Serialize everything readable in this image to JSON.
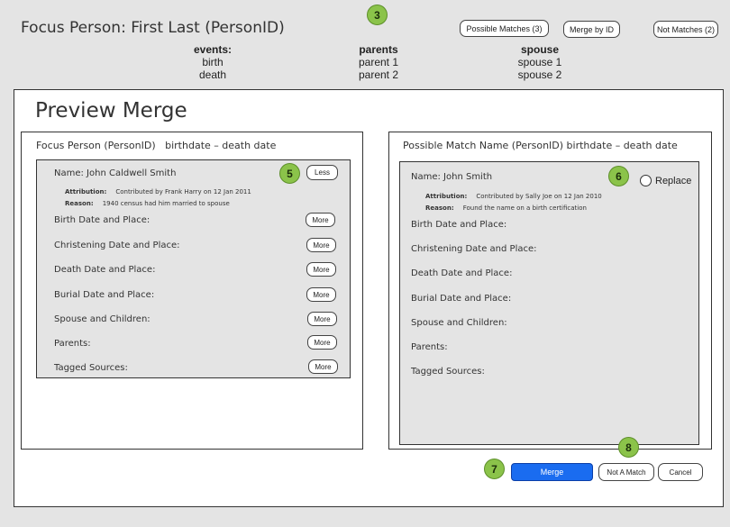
{
  "header": {
    "title": "Focus Person: First  Last  (PersonID)",
    "badge": "3",
    "buttons": {
      "possible_matches": "Possible Matches (3)",
      "merge_by_id": "Merge by ID",
      "not_matches": "Not Matches (2)"
    },
    "columns": [
      {
        "heading": "events:",
        "items": [
          "birth",
          "death"
        ]
      },
      {
        "heading": "parents",
        "items": [
          "parent 1",
          "parent 2"
        ]
      },
      {
        "heading": "spouse",
        "items": [
          "spouse 1",
          "spouse 2"
        ]
      }
    ]
  },
  "modal": {
    "title": "Preview Merge",
    "left": {
      "heading": "Focus Person (PersonID)   birthdate – death date",
      "name": "Name: John Caldwell Smith",
      "attribution_label": "Attribution:",
      "attribution": "Contributed by Frank Harry on 12 Jan 2011",
      "reason_label": "Reason:",
      "reason": "1940 census had him married to spouse",
      "badge": "5",
      "less_label": "Less",
      "more_label": "More",
      "fields": [
        "Birth Date and Place:",
        "Christening Date and Place:",
        "Death Date and Place:",
        "Burial Date and Place:",
        "Spouse and Children:",
        "Parents:",
        "Tagged Sources:"
      ]
    },
    "right": {
      "heading": "Possible Match Name (PersonID) birthdate – death date",
      "name": "Name: John Smith",
      "attribution_label": "Attribution:",
      "attribution": "Contributed by Sally Joe on 12 Jan 2010",
      "reason_label": "Reason:",
      "reason": "Found the name on a birth certification",
      "badge": "6",
      "replace_label": "Replace",
      "fields": [
        "Birth Date and Place:",
        "Christening Date and Place:",
        "Death Date and Place:",
        "Burial Date and Place:",
        "Spouse and Children:",
        "Parents:",
        "Tagged Sources:"
      ]
    },
    "footer": {
      "badge_merge": "7",
      "badge_notmatch": "8",
      "merge_label": "Merge",
      "not_a_match_label": "Not A Match",
      "cancel_label": "Cancel",
      "merge_color": "#1a6cf0"
    }
  }
}
